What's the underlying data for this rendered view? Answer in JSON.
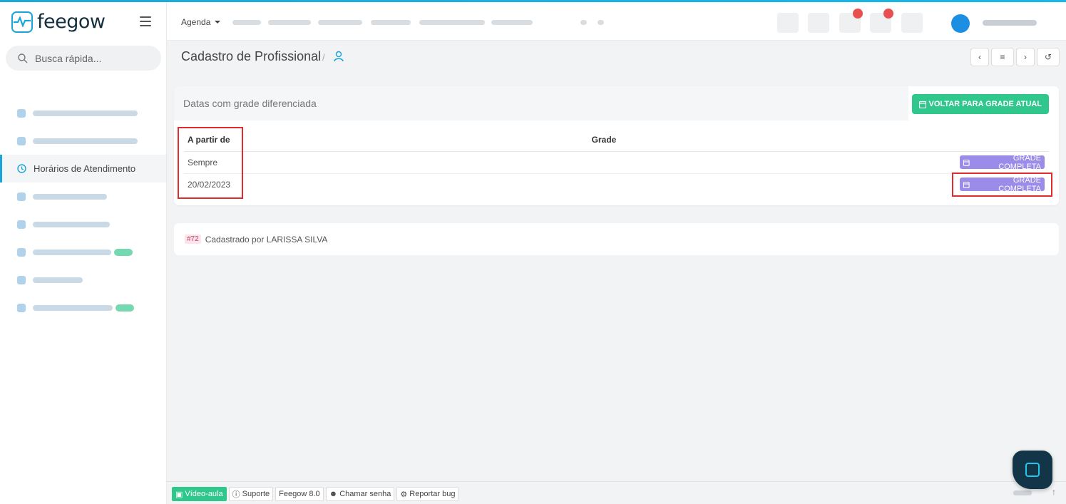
{
  "app": {
    "logo_text": "feegow"
  },
  "sidebar": {
    "search_placeholder": "Busca rápida...",
    "active_item": "Horários de Atendimento"
  },
  "topbar": {
    "agenda_label": "Agenda"
  },
  "page": {
    "title": "Cadastro de Profissional",
    "separator": "/"
  },
  "panel": {
    "title": "Datas com grade diferenciada",
    "voltar_button": "VOLTAR PARA GRADE ATUAL",
    "columns": [
      "A partir de",
      "Grade"
    ],
    "rows": [
      {
        "date": "Sempre",
        "action": "GRADE COMPLETA"
      },
      {
        "date": "20/02/2023",
        "action": "GRADE COMPLETA"
      }
    ]
  },
  "info": {
    "id_tag": "#72",
    "text": "Cadastrado por LARISSA SILVA"
  },
  "footer": {
    "video": "Vídeo-aula",
    "suporte": "Suporte",
    "version": "Feegow 8.0",
    "chamar": "Chamar senha",
    "bug": "Reportar bug"
  },
  "colors": {
    "accent": "#1aa5d8",
    "green": "#2fc78c",
    "purple": "#9a8ce8",
    "highlight": "#e02c2c"
  }
}
